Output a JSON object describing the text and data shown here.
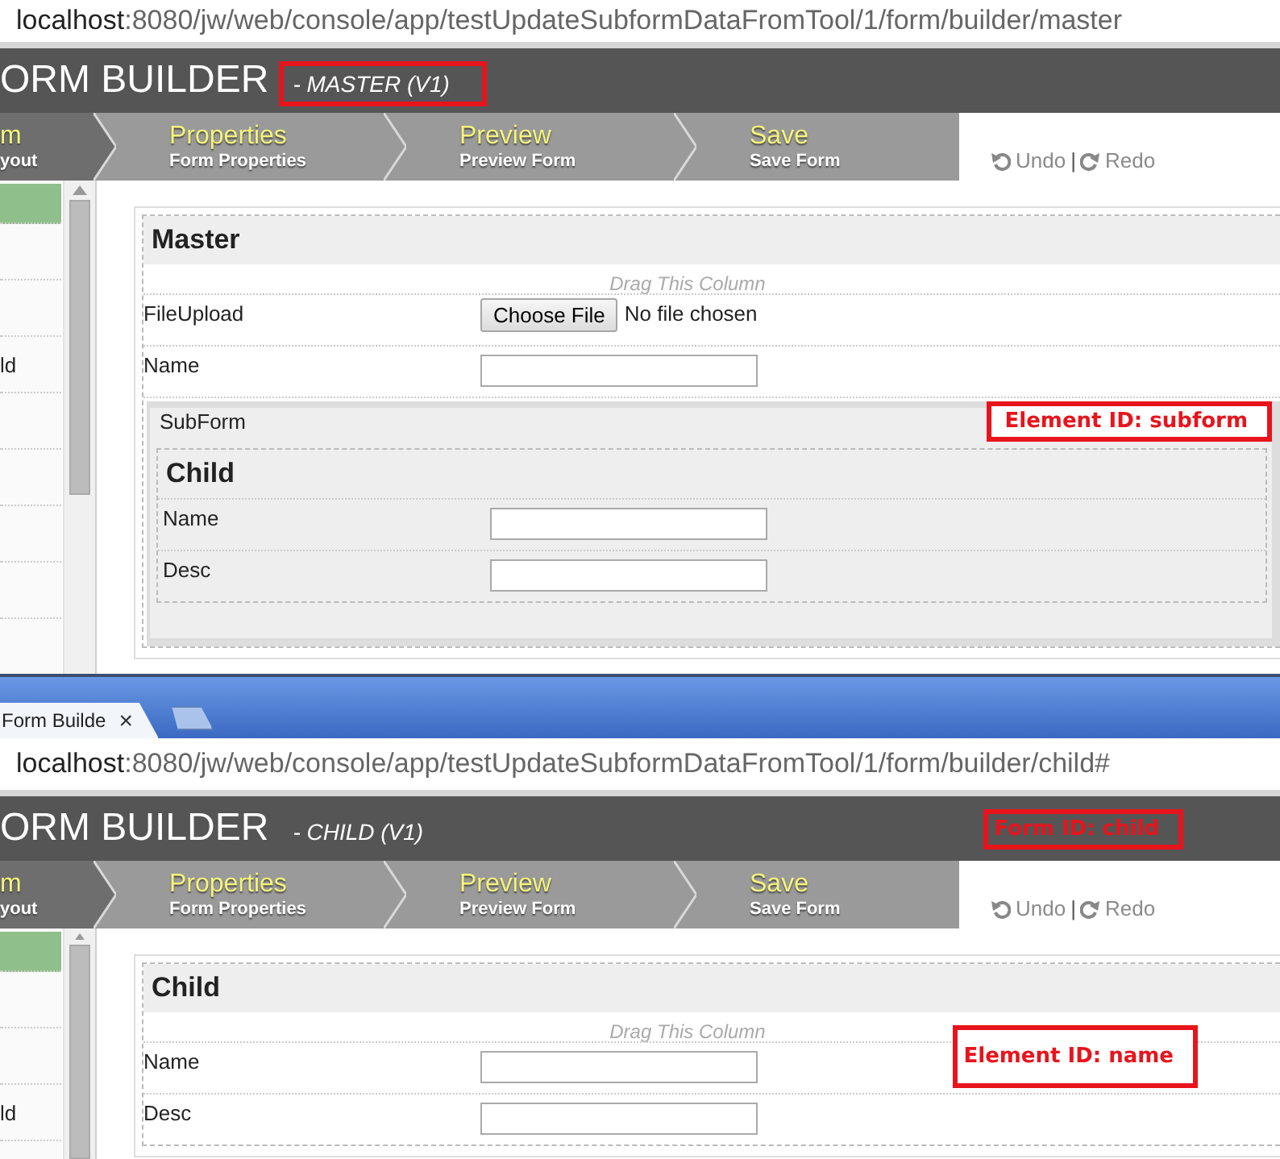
{
  "master_window": {
    "address": {
      "host": "localhost",
      "path": ":8080/jw/web/console/app/testUpdateSubformDataFromTool/1/form/builder/master"
    },
    "header": {
      "title": "ORM BUILDER",
      "subtitle": "- MASTER (V1)",
      "subtitle_highlighted": true
    },
    "steps": [
      {
        "label": "m",
        "sublabel": "yout",
        "selected": true
      },
      {
        "label": "Properties",
        "sublabel": "Form Properties",
        "selected": false
      },
      {
        "label": "Preview",
        "sublabel": "Preview Form",
        "selected": false
      },
      {
        "label": "Save",
        "sublabel": "Save Form",
        "selected": false
      }
    ],
    "undo": "Undo",
    "separator": "|",
    "redo": "Redo",
    "palette": [
      {
        "selected": true
      },
      {
        "selected": false
      },
      {
        "selected": false
      },
      {
        "label": "ld",
        "selected": false
      },
      {
        "selected": false
      },
      {
        "selected": false
      },
      {
        "selected": false
      },
      {
        "selected": false
      }
    ],
    "form": {
      "title": "Master",
      "drag_hint": "Drag This Column",
      "fields": [
        {
          "kind": "file",
          "label": "FileUpload",
          "button": "Choose File",
          "status": "No file chosen"
        },
        {
          "kind": "text",
          "label": "Name"
        },
        {
          "kind": "subform",
          "label": "SubForm",
          "annotation": "Element ID: subform",
          "title": "Child",
          "fields": [
            {
              "kind": "text",
              "label": "Name"
            },
            {
              "kind": "text",
              "label": "Desc"
            }
          ]
        }
      ]
    }
  },
  "browser_tabs": {
    "tabs": [
      {
        "label": "Form Builde",
        "close": "×",
        "selected": true
      }
    ]
  },
  "child_window": {
    "address": {
      "host": "localhost",
      "path": ":8080/jw/web/console/app/testUpdateSubformDataFromTool/1/form/builder/child#"
    },
    "header": {
      "title": "ORM BUILDER",
      "subtitle": "- CHILD (V1)",
      "subtitle_highlighted": false,
      "annotation": "Form ID: child"
    },
    "steps": [
      {
        "label": "m",
        "sublabel": "yout",
        "selected": true
      },
      {
        "label": "Properties",
        "sublabel": "Form Properties",
        "selected": false
      },
      {
        "label": "Preview",
        "sublabel": "Preview Form",
        "selected": false
      },
      {
        "label": "Save",
        "sublabel": "Save Form",
        "selected": false
      }
    ],
    "undo": "Undo",
    "separator": "|",
    "redo": "Redo",
    "palette": [
      {
        "selected": true
      },
      {
        "selected": false
      },
      {
        "selected": false
      },
      {
        "label": "ld",
        "selected": false
      }
    ],
    "form": {
      "title": "Child",
      "drag_hint": "Drag This Column",
      "fields": [
        {
          "kind": "text",
          "label": "Name",
          "annotation": "Element ID: name"
        },
        {
          "kind": "text",
          "label": "Desc"
        }
      ]
    }
  }
}
